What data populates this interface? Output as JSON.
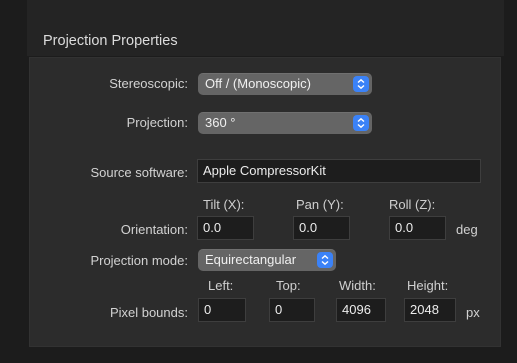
{
  "section_title": "Projection Properties",
  "stereoscopic": {
    "label": "Stereoscopic:",
    "value": "Off / (Monoscopic)"
  },
  "projection": {
    "label": "Projection:",
    "value": "360 °"
  },
  "source_software": {
    "label": "Source software:",
    "value": "Apple CompressorKit"
  },
  "orientation": {
    "label": "Orientation:",
    "tilt_label": "Tilt (X):",
    "tilt": "0.0",
    "pan_label": "Pan (Y):",
    "pan": "0.0",
    "roll_label": "Roll (Z):",
    "roll": "0.0",
    "unit": "deg"
  },
  "projection_mode": {
    "label": "Projection mode:",
    "value": "Equirectangular"
  },
  "pixel_bounds": {
    "label": "Pixel bounds:",
    "left_label": "Left:",
    "left": "0",
    "top_label": "Top:",
    "top": "0",
    "width_label": "Width:",
    "width": "4096",
    "height_label": "Height:",
    "height": "2048",
    "unit": "px"
  },
  "icons": {
    "popup_stepper": "chevron-up-down-icon"
  },
  "colors": {
    "accent": "#3b82f7",
    "panel": "#2c2c2c",
    "field": "#1d1d1d"
  }
}
